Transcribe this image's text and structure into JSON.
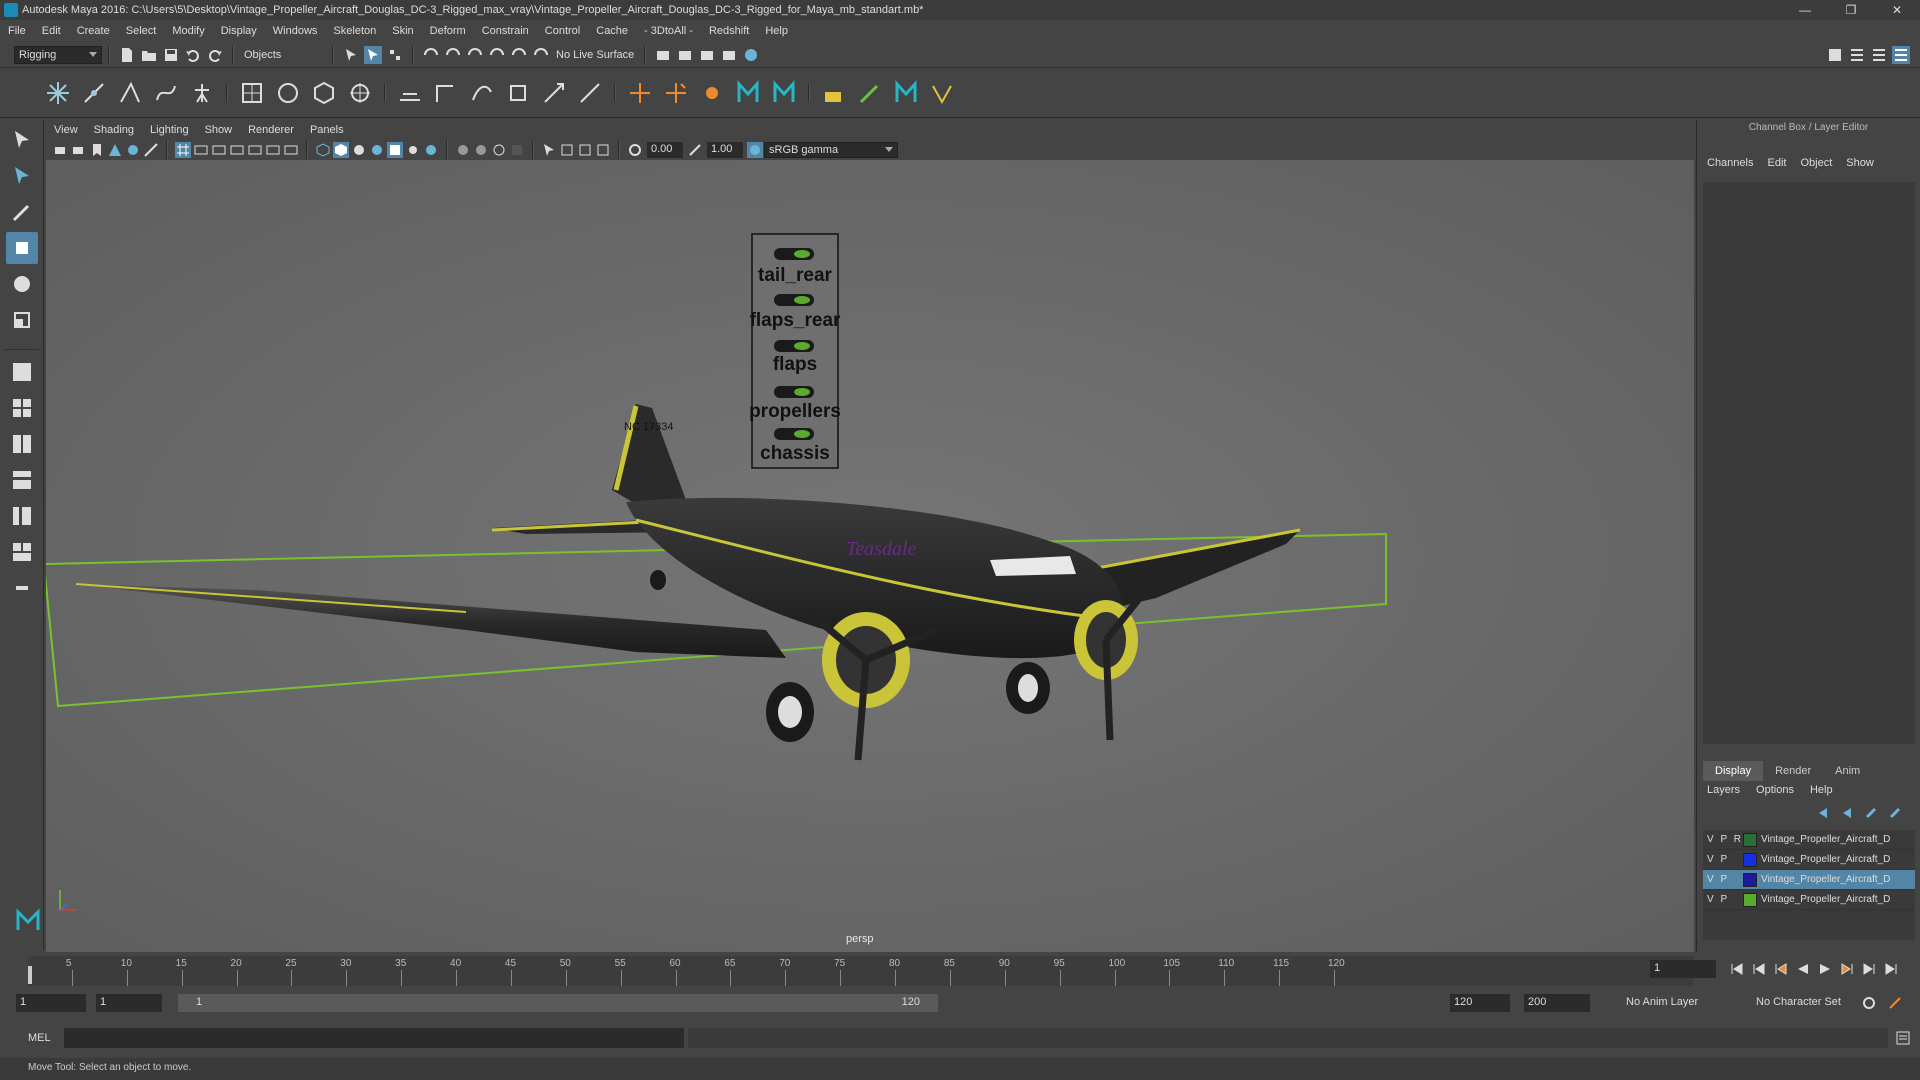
{
  "window": {
    "title": "Autodesk Maya 2016: C:\\Users\\5\\Desktop\\Vintage_Propeller_Aircraft_Douglas_DC-3_Rigged_max_vray\\Vintage_Propeller_Aircraft_Douglas_DC-3_Rigged_for_Maya_mb_standart.mb*",
    "minimize": "—",
    "maximize": "❐",
    "close": "✕"
  },
  "menus": [
    "File",
    "Edit",
    "Create",
    "Select",
    "Modify",
    "Display",
    "Windows",
    "Skeleton",
    "Skin",
    "Deform",
    "Constrain",
    "Control",
    "Cache",
    "- 3DtoAll -",
    "Redshift",
    "Help"
  ],
  "statusline": {
    "mode": "Rigging",
    "objects": "Objects",
    "live_surface": "No Live Surface"
  },
  "panel": {
    "menus": [
      "View",
      "Shading",
      "Lighting",
      "Show",
      "Renderer",
      "Panels"
    ],
    "exposure": "0.00",
    "gamma": "1.00",
    "colorspace": "sRGB gamma",
    "camera": "persp"
  },
  "controls": {
    "items": [
      "tail_rear",
      "flaps_rear",
      "flaps",
      "propellers",
      "chassis"
    ]
  },
  "plane": {
    "tail_code": "NC 17334",
    "logo": "Teasdale"
  },
  "channelbox": {
    "title": "Channel Box / Layer Editor",
    "menus": [
      "Channels",
      "Edit",
      "Object",
      "Show"
    ],
    "tabs": [
      "Display",
      "Render",
      "Anim"
    ],
    "submenus": [
      "Layers",
      "Options",
      "Help"
    ],
    "layers": [
      {
        "flags": "V P R",
        "name": "Vintage_Propeller_Aircraft_D",
        "color": "#2a6e3a"
      },
      {
        "flags": "V P",
        "name": "Vintage_Propeller_Aircraft_D",
        "color": "#1530e0"
      },
      {
        "flags": "V P",
        "name": "Vintage_Propeller_Aircraft_D",
        "color": "#1a1a9a"
      },
      {
        "flags": "V P",
        "name": "Vintage_Propeller_Aircraft_D",
        "color": "#5aaa30"
      }
    ]
  },
  "timeline": {
    "ticks": [
      5,
      10,
      15,
      20,
      25,
      30,
      35,
      40,
      45,
      50,
      55,
      60,
      65,
      70,
      75,
      80,
      85,
      90,
      95,
      100,
      105,
      110,
      115,
      120
    ],
    "current_frame": "1"
  },
  "range": {
    "start": "1",
    "start2": "1",
    "bar_start": "1",
    "bar_end": "120",
    "end": "120",
    "end2": "200",
    "anim_layer": "No Anim Layer",
    "char_set": "No Character Set"
  },
  "cmd": {
    "label": "MEL"
  },
  "help": "Move Tool: Select an object to move."
}
